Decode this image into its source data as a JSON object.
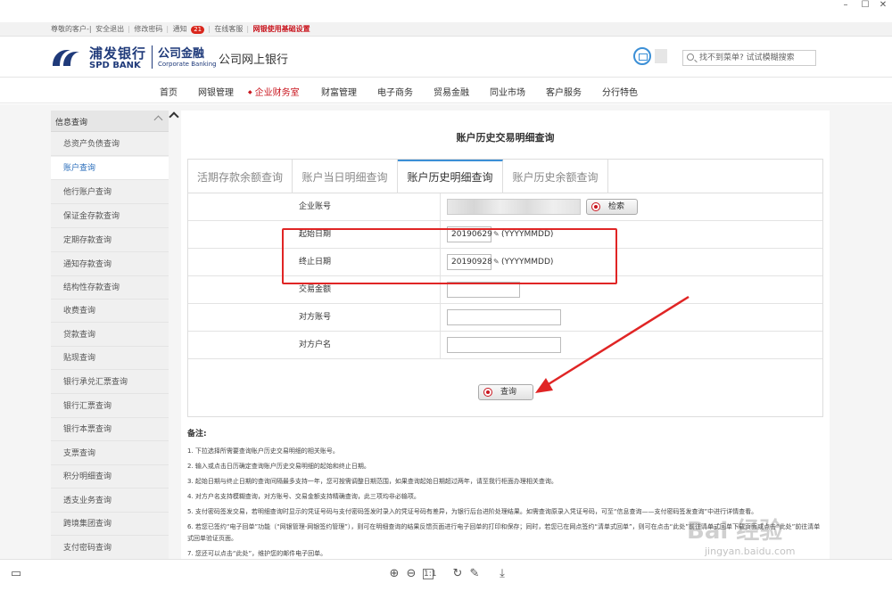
{
  "window": {
    "minimize": "–",
    "maximize": "☐",
    "close": "✕"
  },
  "util_bar": {
    "greeting": "尊敬的客户-|",
    "logout": "安全退出",
    "change_password": "修改密码",
    "notice": "通知",
    "notice_count": "21",
    "online_service": "在线客服",
    "settings": "网银使用基础设置"
  },
  "header": {
    "bank_cn": "浦发银行",
    "bank_en": "SPD BANK",
    "corp_cn": "公司金融",
    "corp_en": "Corporate Banking",
    "site_title": "公司网上银行",
    "search_placeholder": "找不到菜单? 试试模糊搜索"
  },
  "nav": [
    "首页",
    "网银管理",
    "企业财务室",
    "财富管理",
    "电子商务",
    "贸易金融",
    "同业市场",
    "客户服务",
    "分行特色"
  ],
  "nav_active": "企业财务室",
  "sidebar": {
    "section": "信息查询",
    "items": [
      "总资产负债查询",
      "账户查询",
      "他行账户查询",
      "保证金存款查询",
      "定期存款查询",
      "通知存款查询",
      "结构性存款查询",
      "收费查询",
      "贷款查询",
      "贴现查询",
      "银行承兑汇票查询",
      "银行汇票查询",
      "银行本票查询",
      "支票查询",
      "积分明细查询",
      "透支业务查询",
      "跨境集团查询",
      "支付密码查询"
    ],
    "active": "账户查询"
  },
  "panel": {
    "title": "账户历史交易明细查询",
    "tabs": [
      "活期存款余额查询",
      "账户当日明细查询",
      "账户历史明细查询",
      "账户历史余额查询"
    ],
    "active_tab": "账户历史明细查询",
    "fields": {
      "account_label": "企业账号",
      "search_button": "检索",
      "start_label": "起始日期",
      "start_value": "20190629",
      "end_label": "终止日期",
      "end_value": "20190928",
      "date_format": "(YYYYMMDD)",
      "amount_label": "交易金额",
      "counter_account_label": "对方账号",
      "counter_name_label": "对方户名",
      "query_button": "查询"
    }
  },
  "notes": {
    "title": "备注:",
    "items": [
      "1. 下拉选择所需要查询账户历史交易明细的相关账号。",
      "2. 输入或点击日历确定查询账户历史交易明细的起始和终止日期。",
      "3. 起始日期与终止日期的查询间隔最多支持一年，您可按需调整日期范围，如果查询起始日期超过两年，请至我行柜面办理相关查询。",
      "4. 对方户名支持模糊查询，对方账号、交易金额支持精确查询，此三项均非必输项。",
      "5. 支付密码签发交易，若明细查询时显示的凭证号码与支付密码签发时录入的凭证号码有差异，为银行后台进阶处理结果。如需查询原录入凭证号码，可至“信息查询——支付密码签发查询”中进行详情查看。",
      "6. 若您已签约“电子回单”功能（“网银管理-网银签约管理”），则可在明细查询的结果反馈页面进行电子回单的打印和保存；同时，若您已在网点签约“清单式回单”，则可在点击“此处”前往清单式回单下载页面或点击“此处”前往清单式回单验证页面。",
      "7. 您还可以点击“此处”，维护您的邮件电子回单。"
    ]
  },
  "watermark": {
    "main": "Bai 经验",
    "sub": "jingyan.baidu.com"
  },
  "icons": {
    "search": "search-icon",
    "calendar": "calendar-icon",
    "chevron": "chevron-up-icon",
    "zoom_in": "zoom-in-icon",
    "zoom_out": "zoom-out-icon",
    "fit": "fit-page-icon",
    "rotate": "rotate-icon",
    "edit": "pencil-icon",
    "download": "download-icon",
    "panel": "panel-icon"
  },
  "colors": {
    "brand": "#1f3a7a",
    "accent_red": "#c9151e",
    "link_blue": "#2a6ebb",
    "highlight": "#e02525"
  }
}
